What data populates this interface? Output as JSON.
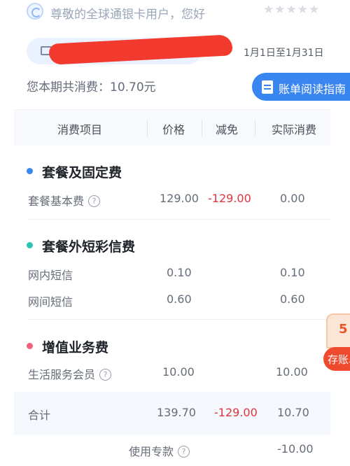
{
  "header": {
    "greeting": "尊敬的全球通银卡用户，您好",
    "stars": "★★★★★",
    "date_range": "1月1日至1月31日",
    "total_text": "您本期共消费：10.70元",
    "guide_button": "账单阅读指南"
  },
  "table": {
    "columns": [
      "消费项目",
      "价格",
      "减免",
      "实际消费"
    ],
    "sections": [
      {
        "title": "套餐及固定费",
        "dot_color": "#3a86f0",
        "rows": [
          {
            "name": "套餐基本费",
            "help": true,
            "price": "129.00",
            "discount": "-129.00",
            "actual": "0.00"
          }
        ]
      },
      {
        "title": "套餐外短彩信费",
        "dot_color": "#2fc3b2",
        "rows": [
          {
            "name": "网内短信",
            "help": false,
            "price": "0.10",
            "discount": "",
            "actual": "0.10"
          },
          {
            "name": "网间短信",
            "help": false,
            "price": "0.60",
            "discount": "",
            "actual": "0.60"
          }
        ]
      },
      {
        "title": "增值业务费",
        "dot_color": "#f0607a",
        "rows": [
          {
            "name": "生活服务会员",
            "help": true,
            "price": "10.00",
            "discount": "",
            "actual": "10.00"
          }
        ]
      }
    ],
    "summary": {
      "label": "合计",
      "price": "139.70",
      "discount": "-129.00",
      "actual": "10.70"
    },
    "usage": {
      "label": "使用专款",
      "help": true,
      "actual": "-10.00"
    }
  },
  "float_badge": {
    "top_text": "5",
    "bottom_text": "存账单"
  },
  "help_icon": "?",
  "colors": {
    "brand_blue": "#3a86f0",
    "discount_red": "#e0343e"
  }
}
